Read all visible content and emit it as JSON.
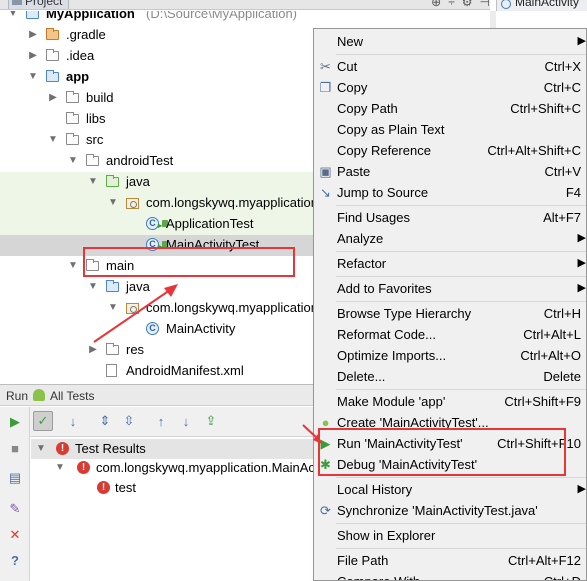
{
  "project_panel": {
    "tab_label": "Project",
    "header_icons": [
      "⊕",
      "÷",
      "⚙",
      "⊣"
    ],
    "editor_tab": "MainActivity"
  },
  "tree": [
    {
      "label": "MyApplication",
      "extra": "(D:\\Source\\MyApplication)",
      "icon": "module-folder-icon",
      "arrow": "expanded",
      "bold": true
    },
    {
      "label": ".gradle",
      "icon": "folder-orange-icon",
      "arrow": "collapsed"
    },
    {
      "label": ".idea",
      "icon": "folder-icon",
      "arrow": "collapsed"
    },
    {
      "label": "app",
      "icon": "module-folder-icon",
      "arrow": "expanded",
      "bold": true
    },
    {
      "label": "build",
      "icon": "folder-icon",
      "arrow": "collapsed"
    },
    {
      "label": "libs",
      "icon": "folder-icon",
      "arrow": "none"
    },
    {
      "label": "src",
      "icon": "folder-icon",
      "arrow": "expanded"
    },
    {
      "label": "androidTest",
      "icon": "folder-icon",
      "arrow": "expanded"
    },
    {
      "label": "java",
      "icon": "folder-green-icon",
      "arrow": "expanded"
    },
    {
      "label": "com.longskywq.myapplication",
      "icon": "package-icon",
      "arrow": "expanded"
    },
    {
      "label": "ApplicationTest",
      "icon": "test-class-icon",
      "arrow": "none"
    },
    {
      "label": "MainActivityTest",
      "icon": "test-class-icon",
      "arrow": "none"
    },
    {
      "label": "main",
      "icon": "folder-icon",
      "arrow": "expanded"
    },
    {
      "label": "java",
      "icon": "folder-blue-icon",
      "arrow": "expanded"
    },
    {
      "label": "com.longskywq.myapplication",
      "icon": "package-icon",
      "arrow": "expanded"
    },
    {
      "label": "MainActivity",
      "icon": "class-icon",
      "arrow": "none"
    },
    {
      "label": "res",
      "icon": "folder-icon",
      "arrow": "collapsed"
    },
    {
      "label": "AndroidManifest.xml",
      "icon": "file-icon",
      "arrow": "none"
    }
  ],
  "run_panel": {
    "title": "Run",
    "tab": "All Tests",
    "results": [
      {
        "label": "Test Results",
        "level": 0
      },
      {
        "label": "com.longskywq.myapplication.MainAc",
        "level": 1
      },
      {
        "label": "test",
        "level": 2
      }
    ]
  },
  "context_menu": {
    "items": [
      {
        "label": "New",
        "shortcut": "",
        "submenu": true,
        "icon": ""
      },
      {
        "sep": true
      },
      {
        "label": "Cut",
        "shortcut": "Ctrl+X",
        "icon": "scissors-icon"
      },
      {
        "label": "Copy",
        "shortcut": "Ctrl+C",
        "icon": "copy-icon"
      },
      {
        "label": "Copy Path",
        "shortcut": "Ctrl+Shift+C",
        "icon": ""
      },
      {
        "label": "Copy as Plain Text",
        "shortcut": "",
        "icon": ""
      },
      {
        "label": "Copy Reference",
        "shortcut": "Ctrl+Alt+Shift+C",
        "icon": ""
      },
      {
        "label": "Paste",
        "shortcut": "Ctrl+V",
        "icon": "paste-icon"
      },
      {
        "label": "Jump to Source",
        "shortcut": "F4",
        "icon": "jump-icon"
      },
      {
        "sep": true
      },
      {
        "label": "Find Usages",
        "shortcut": "Alt+F7",
        "icon": ""
      },
      {
        "label": "Analyze",
        "shortcut": "",
        "submenu": true,
        "icon": ""
      },
      {
        "sep": true
      },
      {
        "label": "Refactor",
        "shortcut": "",
        "submenu": true,
        "icon": ""
      },
      {
        "sep": true
      },
      {
        "label": "Add to Favorites",
        "shortcut": "",
        "submenu": true,
        "icon": ""
      },
      {
        "sep": true
      },
      {
        "label": "Browse Type Hierarchy",
        "shortcut": "Ctrl+H",
        "icon": ""
      },
      {
        "label": "Reformat Code...",
        "shortcut": "Ctrl+Alt+L",
        "icon": ""
      },
      {
        "label": "Optimize Imports...",
        "shortcut": "Ctrl+Alt+O",
        "icon": ""
      },
      {
        "label": "Delete...",
        "shortcut": "Delete",
        "icon": ""
      },
      {
        "sep": true
      },
      {
        "label": "Make Module 'app'",
        "shortcut": "Ctrl+Shift+F9",
        "icon": ""
      },
      {
        "label": "Create 'MainActivityTest'...",
        "shortcut": "",
        "icon": "android-icon"
      },
      {
        "label": "Run 'MainActivityTest'",
        "shortcut": "Ctrl+Shift+F10",
        "icon": "run-icon"
      },
      {
        "label": "Debug 'MainActivityTest'",
        "shortcut": "",
        "icon": "debug-icon"
      },
      {
        "sep": true
      },
      {
        "label": "Local History",
        "shortcut": "",
        "submenu": true,
        "icon": ""
      },
      {
        "label": "Synchronize 'MainActivityTest.java'",
        "shortcut": "",
        "icon": "sync-icon"
      },
      {
        "sep": true
      },
      {
        "label": "Show in Explorer",
        "shortcut": "",
        "icon": ""
      },
      {
        "sep": true
      },
      {
        "label": "File Path",
        "shortcut": "Ctrl+Alt+F12",
        "icon": ""
      },
      {
        "label": "Compare With...",
        "shortcut": "Ctrl+D",
        "icon": ""
      }
    ]
  },
  "colors": {
    "annotation_red": "#e8353a",
    "selection": "#d6d6d6",
    "test_root_tint": "#eef6e7"
  }
}
